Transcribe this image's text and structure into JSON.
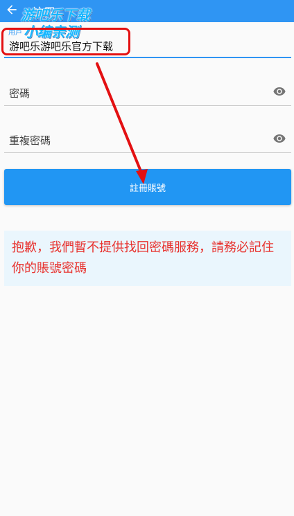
{
  "appbar": {
    "title": "註冊",
    "back_icon": "arrow-left-icon"
  },
  "watermark": {
    "line1": "游吧乐下载",
    "line2": "小编亲测"
  },
  "form": {
    "username": {
      "label": "用戶",
      "value": "游吧乐游吧乐官方下载"
    },
    "password": {
      "placeholder": "密碼",
      "icon": "eye-icon"
    },
    "confirm_password": {
      "placeholder": "重複密碼",
      "icon": "eye-icon"
    }
  },
  "register_button": {
    "label": "註冊賬號"
  },
  "notice": {
    "text": "抱歉，我們暫不提供找回密碼服務，請務必記住你的賬號密碼"
  },
  "colors": {
    "primary": "#2f95f3",
    "annotation": "#e31012",
    "notice_text": "#e8332f",
    "notice_bg": "#eaf6fd"
  }
}
